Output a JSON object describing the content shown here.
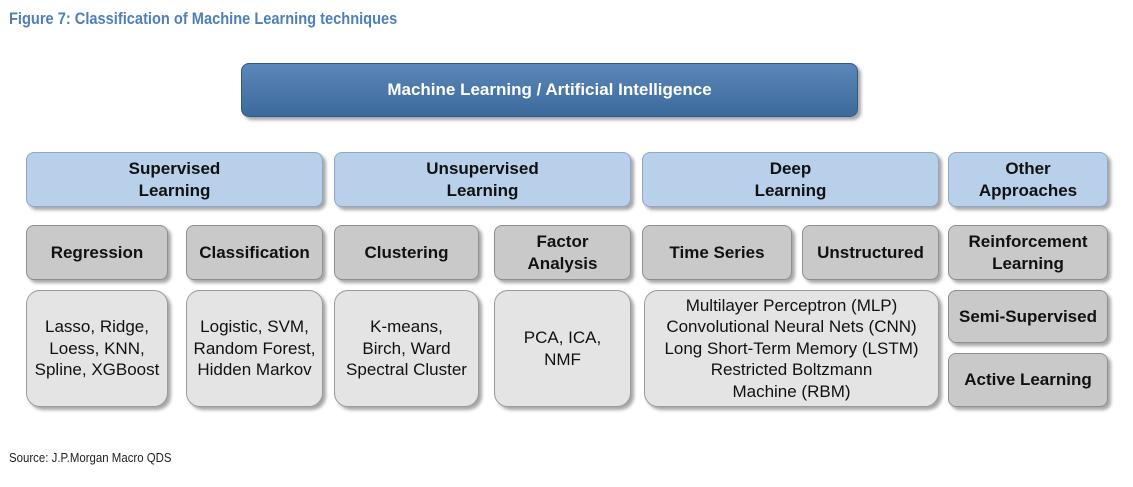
{
  "title": "Figure 7: Classification of Machine Learning techniques",
  "root": "Machine Learning / Artificial  Intelligence",
  "categories": {
    "supervised": "Supervised\nLearning",
    "unsupervised": "Unsupervised\nLearning",
    "deep": "Deep\nLearning",
    "other": "Other\nApproaches"
  },
  "subcategories": {
    "regression": "Regression",
    "classification": "Classification",
    "clustering": "Clustering",
    "factor_analysis": "Factor\nAnalysis",
    "time_series": "Time Series",
    "unstructured": "Unstructured",
    "reinforcement": "Reinforcement\nLearning",
    "semi_supervised": "Semi-Supervised",
    "active_learning": "Active Learning"
  },
  "leaves": {
    "regression": "Lasso, Ridge,\nLoess, KNN,\nSpline, XGBoost",
    "classification": "Logistic, SVM,\nRandom Forest,\nHidden Markov",
    "clustering": "K-means,\nBirch, Ward\nSpectral Cluster",
    "factor_analysis": "PCA, ICA,\nNMF",
    "deep": "Multilayer  Perceptron (MLP)\nConvolutional  Neural Nets (CNN)\nLong Short-Term  Memory (LSTM)\nRestricted Boltzmann\nMachine (RBM)"
  },
  "source": "Source: J.P.Morgan Macro QDS"
}
